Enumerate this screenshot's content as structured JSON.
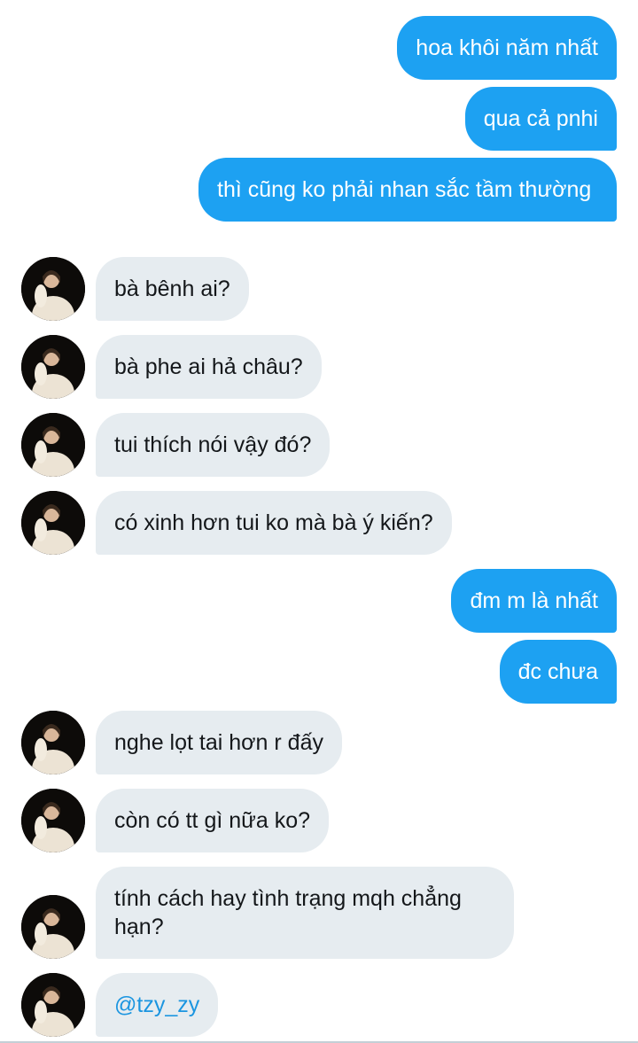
{
  "conversation": {
    "messages": [
      {
        "side": "sent",
        "text": "hoa khôi năm nhất"
      },
      {
        "side": "sent",
        "text": "qua cả pnhi"
      },
      {
        "side": "sent",
        "text": "thì cũng ko phải nhan sắc tầm thường"
      },
      {
        "side": "received",
        "text": "bà bênh ai?"
      },
      {
        "side": "received",
        "text": "bà phe ai hả châu?"
      },
      {
        "side": "received",
        "text": "tui thích nói vậy đó?"
      },
      {
        "side": "received",
        "text": "có xinh hơn tui ko mà bà ý kiến?"
      },
      {
        "side": "sent",
        "text": "đm m là nhất"
      },
      {
        "side": "sent",
        "text": "đc chưa"
      },
      {
        "side": "received",
        "text": "nghe lọt tai hơn r đấy"
      },
      {
        "side": "received",
        "text": "còn có tt gì nữa ko?"
      },
      {
        "side": "received",
        "text": "tính cách hay tình trạng mqh chẳng hạn?"
      },
      {
        "side": "received",
        "text": "@tzy_zy",
        "is_mention": true
      }
    ]
  },
  "colors": {
    "sent_bubble": "#1da1f2",
    "received_bubble": "#e6ecf0",
    "mention_link": "#1b95e0"
  },
  "icons": {
    "avatar": "user-avatar-photo"
  }
}
